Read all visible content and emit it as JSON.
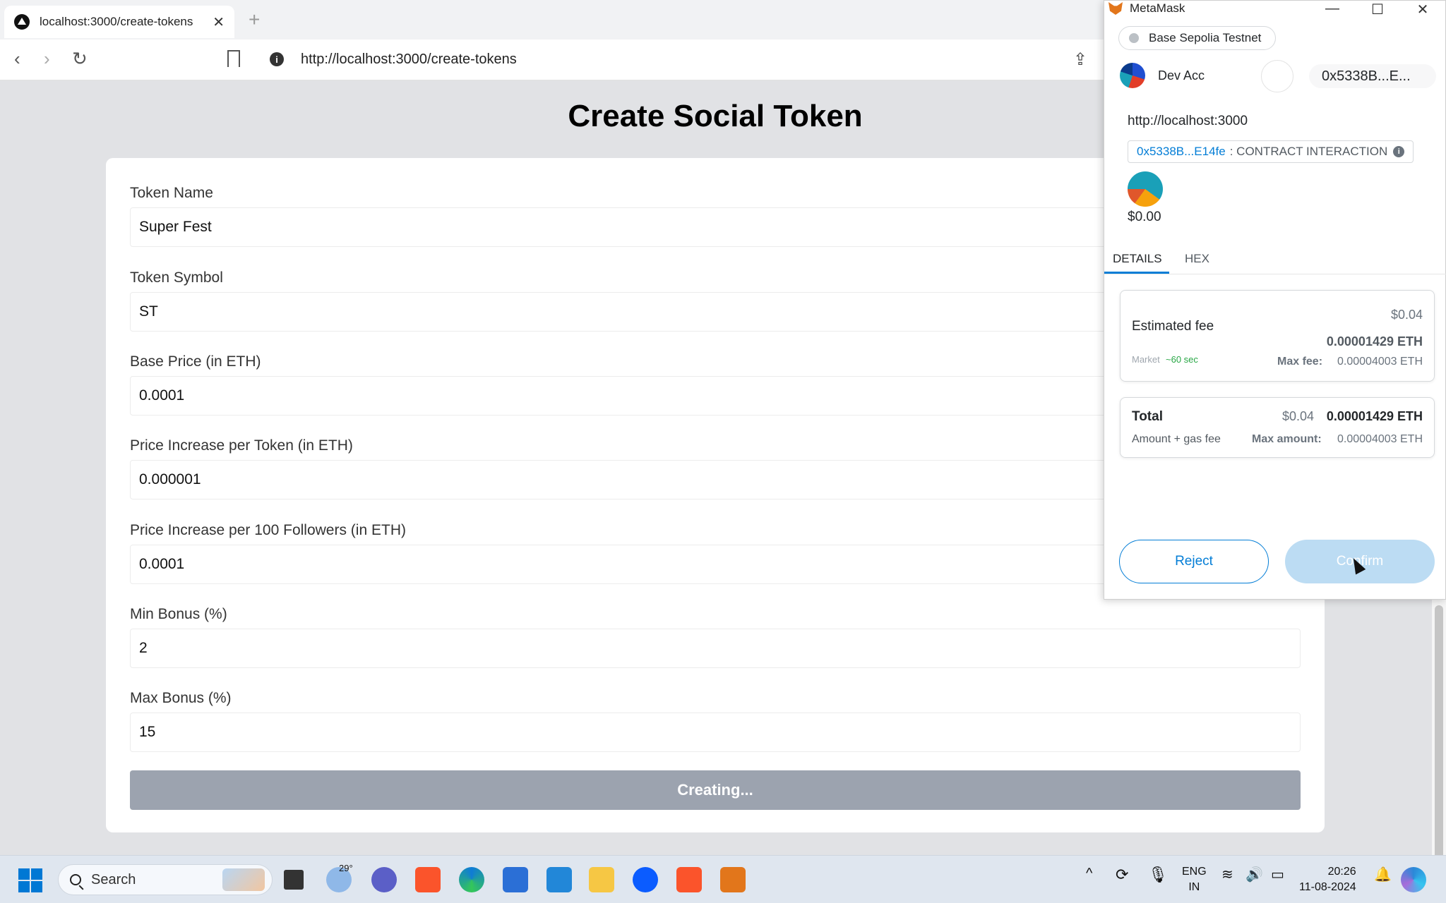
{
  "browser": {
    "tab_title": "localhost:3000/create-tokens",
    "url": "http://localhost:3000/create-tokens"
  },
  "page": {
    "title": "Create Social Token",
    "fields": [
      {
        "label": "Token Name",
        "value": "Super Fest"
      },
      {
        "label": "Token Symbol",
        "value": "ST"
      },
      {
        "label": "Base Price (in ETH)",
        "value": "0.0001"
      },
      {
        "label": "Price Increase per Token (in ETH)",
        "value": "0.000001"
      },
      {
        "label": "Price Increase per 100 Followers (in ETH)",
        "value": "0.0001"
      },
      {
        "label": "Min Bonus (%)",
        "value": "2"
      },
      {
        "label": "Max Bonus (%)",
        "value": "15"
      }
    ],
    "submit_label": "Creating..."
  },
  "metamask": {
    "window_title": "MetaMask",
    "network": "Base Sepolia Testnet",
    "account_name": "Dev Acc",
    "account_address": "0x5338B...E...",
    "origin": "http://localhost:3000",
    "contract_address": "0x5338B...E14fe",
    "contract_label": ": CONTRACT INTERACTION",
    "amount": "$0.00",
    "tabs": [
      "DETAILS",
      "HEX"
    ],
    "estimated_fee_label": "Estimated fee",
    "estimated_fee_usd": "$0.04",
    "estimated_fee_eth": "0.00001429 ETH",
    "market_label": "Market",
    "market_time": "~60 sec",
    "max_fee_label": "Max fee:",
    "max_fee_value": "0.00004003 ETH",
    "total_label": "Total",
    "total_usd": "$0.04",
    "total_eth": "0.00001429 ETH",
    "total_sub_label": "Amount + gas fee",
    "max_amount_label": "Max amount:",
    "max_amount_value": "0.00004003 ETH",
    "reject_label": "Reject",
    "confirm_label": "Confirm"
  },
  "taskbar": {
    "search_placeholder": "Search",
    "weather_temp": "29°",
    "lang_top": "ENG",
    "lang_bottom": "IN",
    "time": "20:26",
    "date": "11-08-2024"
  }
}
